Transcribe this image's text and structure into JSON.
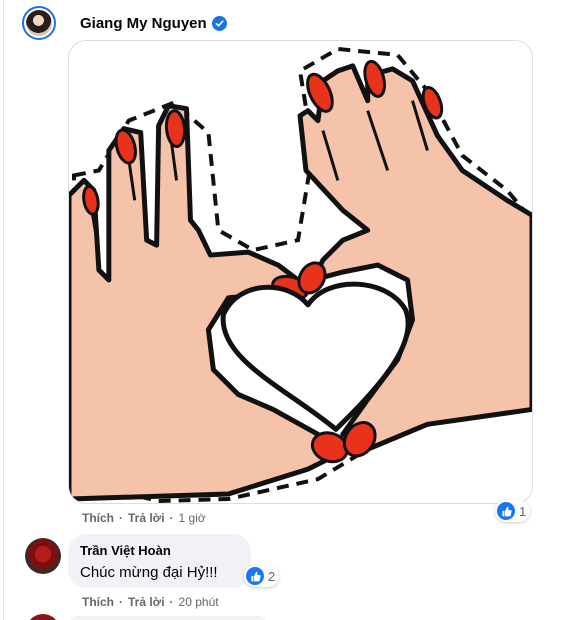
{
  "post": {
    "author": {
      "name": "Giang My Nguyen",
      "verified": true,
      "avatar_icon": "profile-avatar"
    },
    "image": {
      "subject": "hand-heart-illustration",
      "colors": {
        "skin": "#f5c2aa",
        "nail": "#e8321b",
        "outline": "#111111",
        "dashed_border": "#111111"
      }
    },
    "actions": {
      "like": "Thích",
      "reply": "Trả lời",
      "time": "1 giờ"
    },
    "reaction": {
      "icon": "like-icon",
      "count": "1"
    }
  },
  "reply": {
    "author": {
      "name": "Trần Việt Hoàn",
      "avatar_icon": "profile-avatar"
    },
    "text": "Chúc mừng đại Hỷ!!!",
    "reaction": {
      "icon": "like-icon",
      "count": "2"
    },
    "actions": {
      "like": "Thích",
      "reply": "Trả lời",
      "time": "20 phút"
    }
  },
  "colors": {
    "accent": "#1877f2",
    "bubble_bg": "#f0f2f5",
    "meta_text": "#65676b"
  }
}
